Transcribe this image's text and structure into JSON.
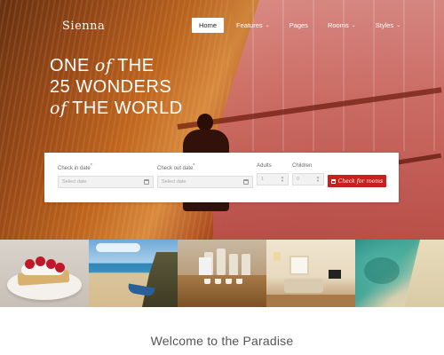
{
  "brand": {
    "logo": "Sienna"
  },
  "nav": {
    "items": [
      {
        "label": "Home",
        "active": true,
        "has_dropdown": false
      },
      {
        "label": "Features",
        "active": false,
        "has_dropdown": true
      },
      {
        "label": "Pages",
        "active": false,
        "has_dropdown": false
      },
      {
        "label": "Rooms",
        "active": false,
        "has_dropdown": true
      },
      {
        "label": "Styles",
        "active": false,
        "has_dropdown": true
      }
    ]
  },
  "hero": {
    "line1_a": "ONE ",
    "line1_em": "of",
    "line1_b": " THE",
    "line2": "25 WONDERS",
    "line3_em": "of",
    "line3_b": " THE WORLD"
  },
  "booking": {
    "check_in": {
      "label": "Check in date",
      "required_mark": "*",
      "placeholder": "Select date"
    },
    "check_out": {
      "label": "Check out date",
      "required_mark": "*",
      "placeholder": "Select date"
    },
    "adults": {
      "label": "Adults",
      "value": "1"
    },
    "children": {
      "label": "Children",
      "value": "0"
    },
    "submit_label": "Check for rooms",
    "accent_color": "#c9201f"
  },
  "welcome": {
    "title": "Welcome to the Paradise"
  }
}
